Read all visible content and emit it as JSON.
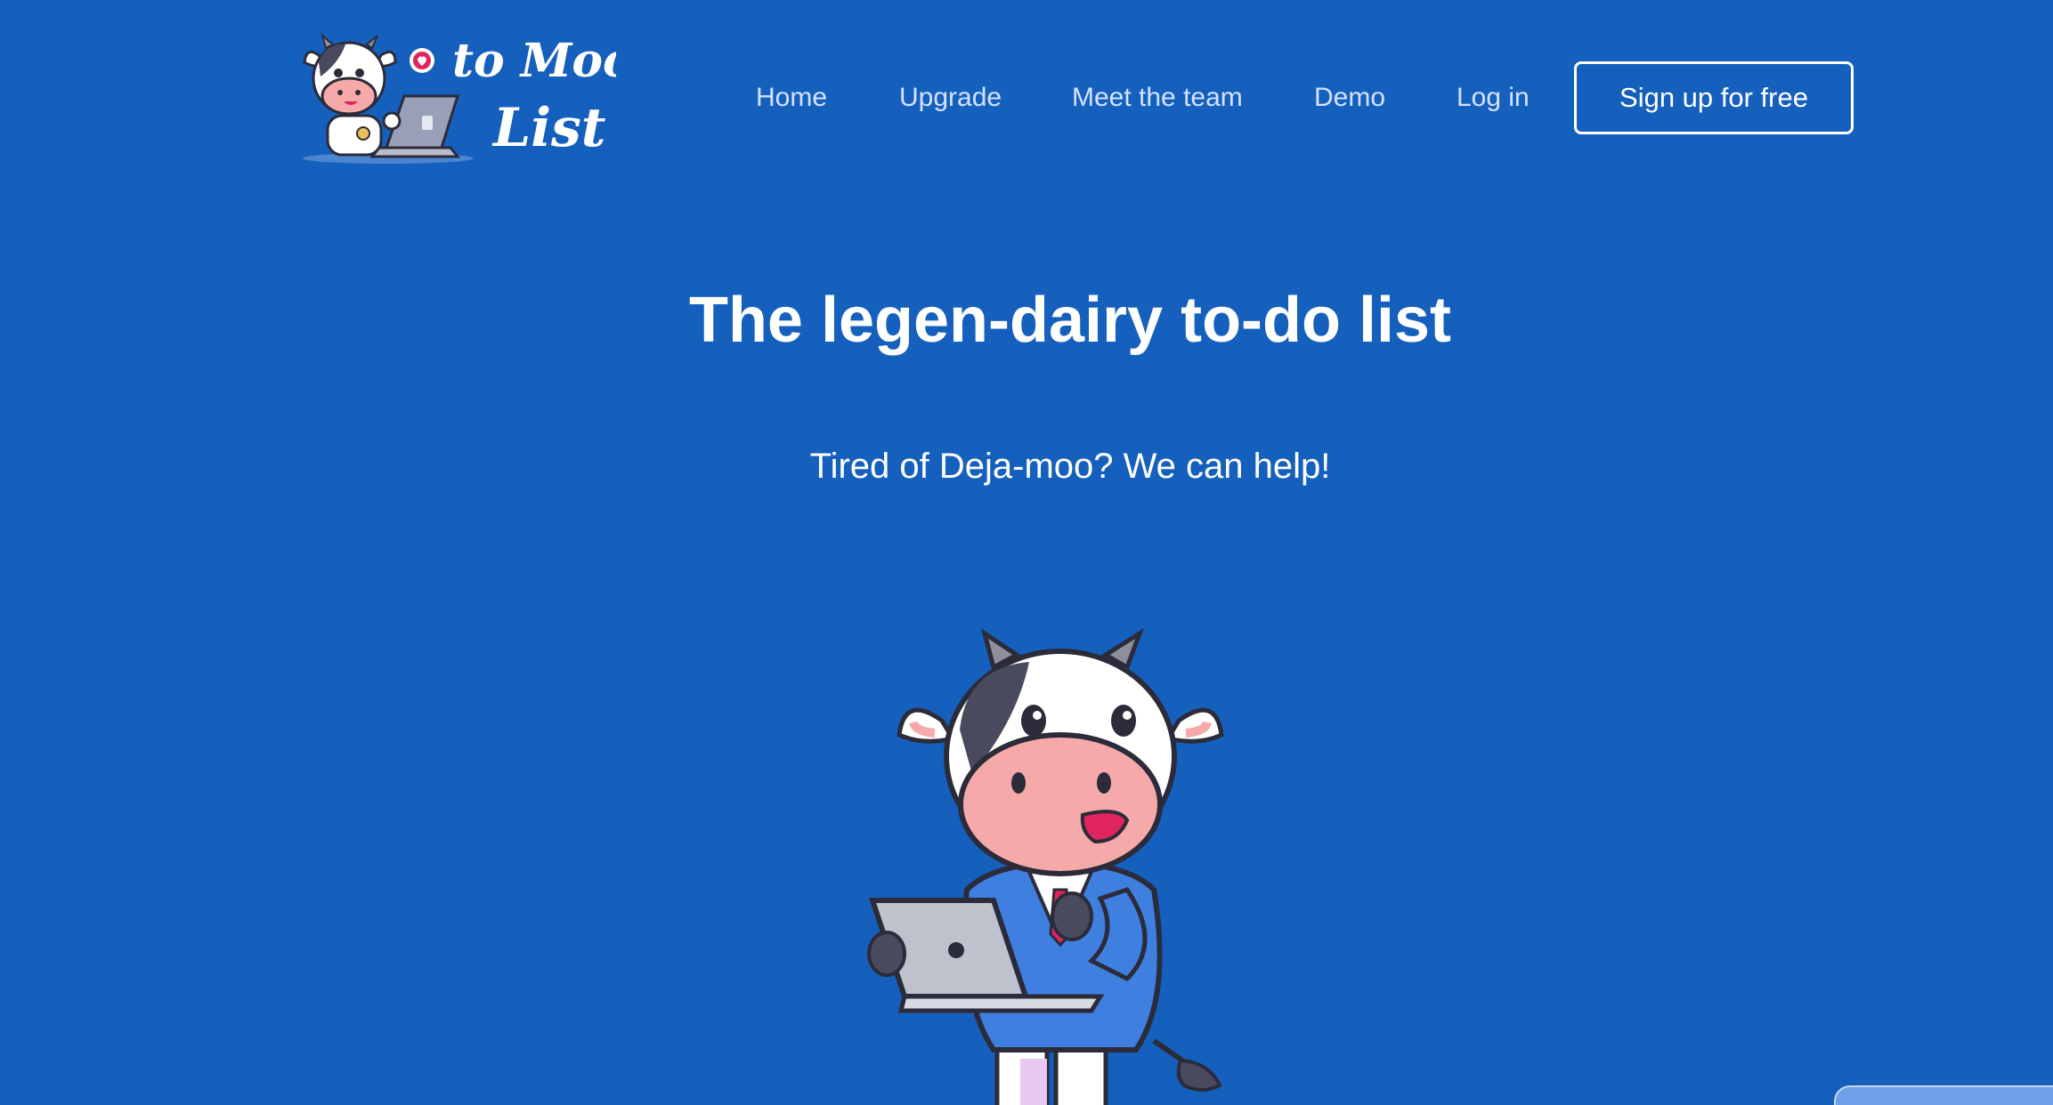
{
  "theme": {
    "background": "#1560BD",
    "nav_link_color": "#d4e2ff",
    "text_color": "#ffffff"
  },
  "logo": {
    "line1": "to Moo",
    "line2": "List"
  },
  "nav": {
    "items": [
      {
        "label": "Home"
      },
      {
        "label": "Upgrade"
      },
      {
        "label": "Meet the team"
      },
      {
        "label": "Demo"
      },
      {
        "label": "Log in"
      }
    ],
    "cta_label": "Sign up for free"
  },
  "hero": {
    "title": "The legen-dairy to-do list",
    "subtitle": "Tired of Deja-moo? We can help!"
  }
}
